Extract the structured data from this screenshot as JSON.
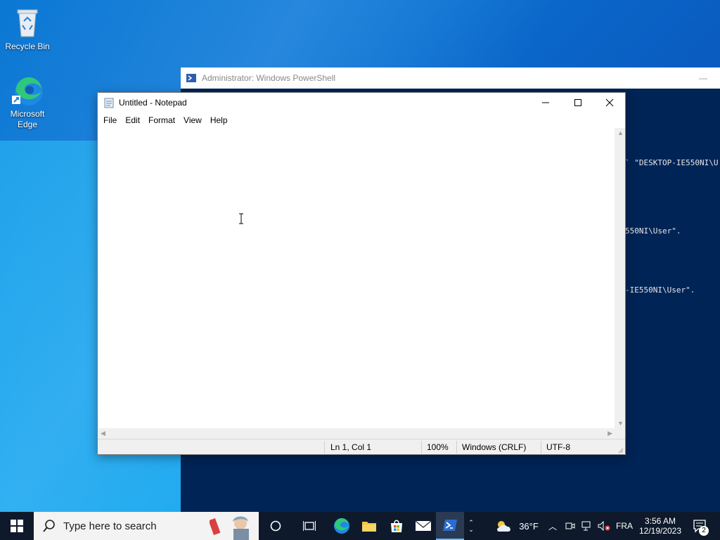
{
  "desktop": {
    "icons": [
      {
        "label": "Recycle Bin"
      },
      {
        "label": "Microsoft Edge"
      }
    ]
  },
  "powershell": {
    "title": "Administrator: Windows PowerShell",
    "lines": [
      "` \"DESKTOP-IE550NI\\U",
      "550NI\\User\".",
      "-IE550NI\\User\"."
    ]
  },
  "notepad": {
    "title": "Untitled - Notepad",
    "menu": [
      "File",
      "Edit",
      "Format",
      "View",
      "Help"
    ],
    "content": "",
    "status": {
      "position": "Ln 1, Col 1",
      "zoom": "100%",
      "line_ending": "Windows (CRLF)",
      "encoding": "UTF-8"
    }
  },
  "taskbar": {
    "search_placeholder": "Type here to search",
    "weather_temp": "36°F",
    "language": "FRA",
    "time": "3:56 AM",
    "date": "12/19/2023",
    "notification_count": "2"
  },
  "colors": {
    "desktop_blue": "#0a78d4",
    "powershell_bg": "#012456",
    "taskbar_bg": "#0e1a2b"
  }
}
